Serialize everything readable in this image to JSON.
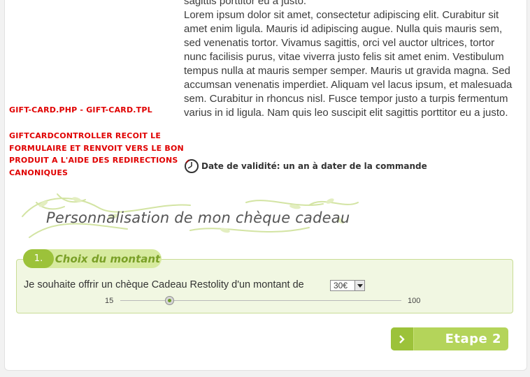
{
  "description": {
    "paragraphs": [
      "sagittis porttitor eu a justo.",
      "Lorem ipsum dolor sit amet, consectetur adipiscing elit. Curabitur sit amet enim ligula. Mauris id adipiscing augue. Nulla quis mauris sem, sed venenatis tortor. Vivamus sagittis, orci vel auctor ultrices, tortor nunc facilisis purus, vitae viverra justo felis sit amet enim. Vestibulum tempus nulla at mauris semper semper. Mauris ut gravida magna. Sed accumsan venenatis imperdiet. Aliquam vel lacus ipsum, et malesuada sem. Curabitur in rhoncus nisl. Fusce tempor justo a turpis fermentum varius in id ligula. Nam quis leo suscipit elit sagittis porttitor eu a justo."
    ]
  },
  "debug": {
    "file_label": "GIFT-CARD.PHP - GIFT-CARD.TPL",
    "controller_note": "GIFTCARDCONTROLLER RECOIT LE FORMULAIRE ET RENVOIT VERS LE BON PRODUIT A L'AIDE DES REDIRECTIONS CANONIQUES"
  },
  "validity": {
    "icon": "clock-icon",
    "text": "Date de validité: un an à dater de la commande"
  },
  "section": {
    "title": "Personnalisation de mon chèque cadeau"
  },
  "step1": {
    "number": "1.",
    "title": "Choix du montant",
    "amount_label": "Je souhaite offrir un chèque Cadeau Restolity d'un montant de",
    "amount_value": "30€",
    "slider": {
      "min_label": "15",
      "max_label": "100",
      "min": 15,
      "max": 100,
      "value": 30
    }
  },
  "next_button": {
    "label": "Etape 2",
    "icon": "chevron-right-icon"
  },
  "colors": {
    "accent": "#9cc23a",
    "accent_light": "#b4d45a",
    "debug_red": "#e00000",
    "panel_bg": "#f1f7e2"
  }
}
